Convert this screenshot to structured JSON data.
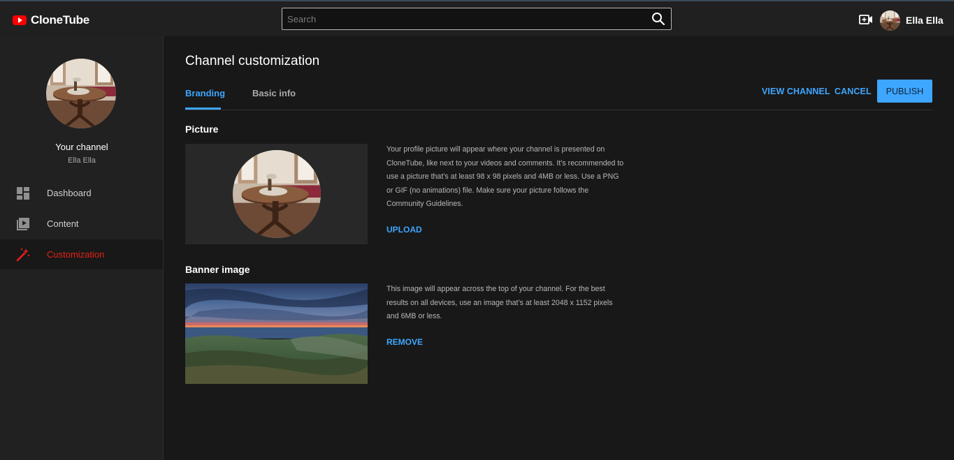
{
  "app": {
    "name": "CloneTube",
    "brand_color": "#ff0000",
    "accent_color": "#3ea6ff"
  },
  "header": {
    "search_placeholder": "Search",
    "search_icon": "search-icon",
    "create_icon": "video-create-icon",
    "user_name": "Ella Ella"
  },
  "sidebar": {
    "channel_label": "Your channel",
    "channel_name": "Ella Ella",
    "items": [
      {
        "label": "Dashboard",
        "icon": "dashboard-icon",
        "active": false
      },
      {
        "label": "Content",
        "icon": "content-icon",
        "active": false
      },
      {
        "label": "Customization",
        "icon": "magic-wand-icon",
        "active": true
      }
    ],
    "active_color": "#e62117"
  },
  "main": {
    "title": "Channel customization",
    "tabs": [
      {
        "label": "Branding",
        "active": true
      },
      {
        "label": "Basic info",
        "active": false
      }
    ],
    "actions": {
      "view_channel": "VIEW CHANNEL",
      "cancel": "CANCEL",
      "publish": "PUBLISH"
    },
    "picture": {
      "title": "Picture",
      "description": "Your profile picture will appear where your channel is presented on CloneTube, like next to your videos and comments. It’s recommended to use a picture that’s at least 98 x 98 pixels and 4MB or less. Use a PNG or GIF (no animations) file. Make sure your picture follows the Community Guidelines.",
      "action": "UPLOAD"
    },
    "banner": {
      "title": "Banner image",
      "description": "This image will appear across the top of your channel. For the best results on all devices, use an image that’s at least 2048 x 1152 pixels and 6MB or less.",
      "action": "REMOVE"
    }
  }
}
